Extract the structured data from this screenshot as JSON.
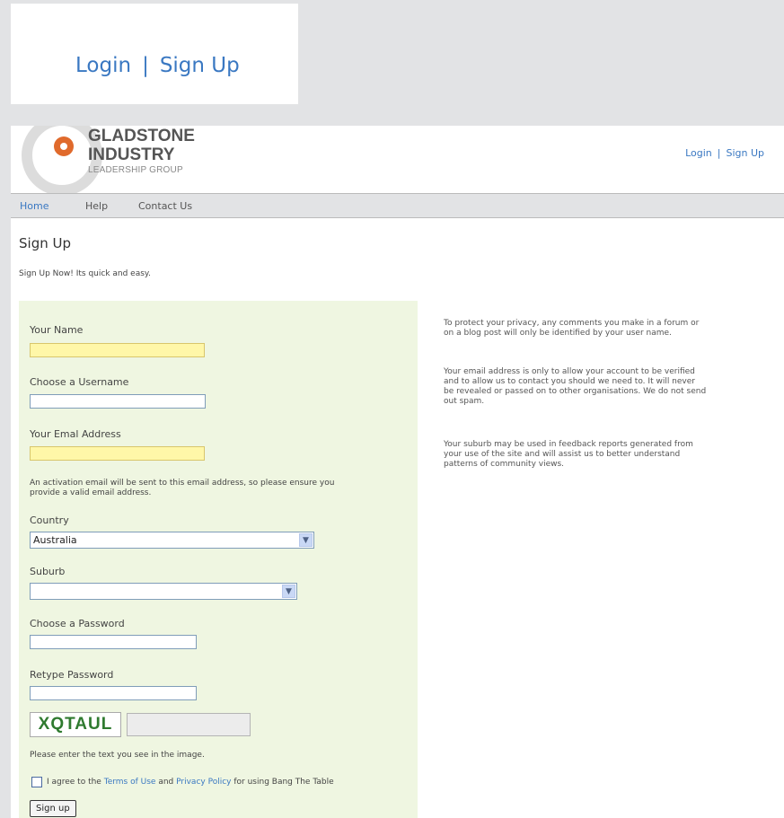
{
  "zoom": {
    "login": "Login",
    "separator": "|",
    "signup": "Sign Up"
  },
  "header": {
    "logo": {
      "line1": "GLADSTONE",
      "line2": "INDUSTRY",
      "line3": "LEADERSHIP GROUP"
    },
    "login": "Login",
    "separator": "|",
    "signup": "Sign Up"
  },
  "nav": {
    "home": "Home",
    "help": "Help",
    "contact": "Contact Us"
  },
  "page": {
    "title": "Sign Up",
    "intro": "Sign Up Now! Its quick and easy."
  },
  "form": {
    "name_label": "Your Name",
    "username_label": "Choose a Username",
    "email_label": "Your Emal Address",
    "email_note_1": "An activation email will be sent to this email address, so please ensure you",
    "email_note_2": "provide a valid email address.",
    "country_label": "Country",
    "country_value": "Australia",
    "suburb_label": "Suburb",
    "suburb_value": "",
    "password_label": "Choose a Password",
    "retype_label": "Retype Password",
    "captcha_text": "XQTAUL",
    "captcha_note": "Please enter the text you see in the image.",
    "agree_prefix": "I agree to the",
    "terms_link": "Terms of Use",
    "and": "and",
    "privacy_link": "Privacy Policy",
    "agree_suffix": "for using Bang The Table",
    "submit": "Sign up"
  },
  "side": {
    "p1_1": "To protect your privacy, any comments you make in a forum or",
    "p1_2": "on a blog post will only be identified by your user name.",
    "p2_1": "Your email address is only to allow your account to be verified",
    "p2_2": "and to allow us to contact you should we need to. It will never",
    "p2_3": "be revealed or passed on to other organisations. We do not send",
    "p2_4": "out spam.",
    "p3_1": "Your suburb may be used in feedback reports generated from",
    "p3_2": "your use of the site and will assist us to better understand",
    "p3_3": "patterns of community views."
  },
  "colors": {
    "accent": "#3a78c2",
    "form_bg": "#eff6e1",
    "required_field": "#fff7a8",
    "logo_orange": "#e06a2c"
  },
  "icons": {
    "select_arrow": "chevron-down-icon",
    "logo": "logo-icon"
  }
}
